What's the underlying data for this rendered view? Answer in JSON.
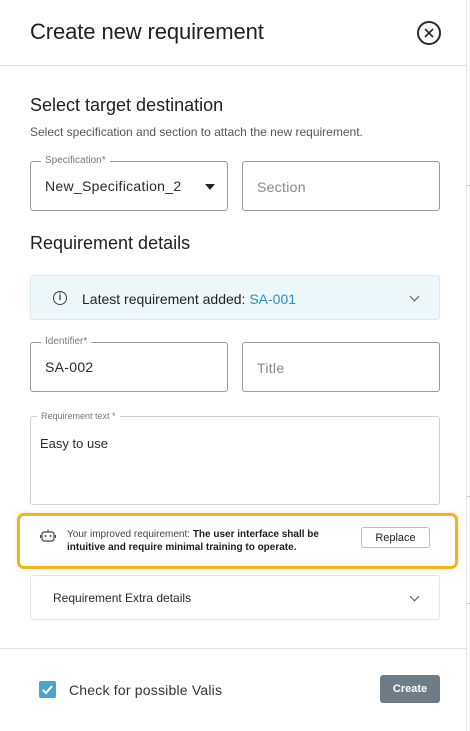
{
  "dialog": {
    "title": "Create new requirement"
  },
  "target": {
    "heading": "Select target destination",
    "subheading": "Select specification and section to attach the new requirement.",
    "specification": {
      "label": "Specification*",
      "value": "New_Specification_2"
    },
    "section": {
      "placeholder": "Section"
    }
  },
  "details": {
    "heading": "Requirement details",
    "latest": {
      "prefix": "Latest requirement added: ",
      "id": "SA-001"
    },
    "identifier": {
      "label": "Identifier*",
      "value": "SA-002"
    },
    "title_field": {
      "placeholder": "Title"
    },
    "requirement_text": {
      "label": "Requirement text *",
      "value": "Easy to use"
    }
  },
  "suggestion": {
    "prefix": "Your improved requirement: ",
    "text": "The user interface shall be intuitive and require minimal training to operate.",
    "replace_label": "Replace",
    "icon": "robot-icon"
  },
  "extra": {
    "label": "Requirement Extra details"
  },
  "footer": {
    "checkbox_label": "Check for possible Valis",
    "checkbox_checked": true,
    "create_label": "Create"
  },
  "colors": {
    "accent": "#2a8fbf",
    "highlight_border": "#f0b429",
    "checkbox": "#4fa3c7",
    "create_button": "#6f7c86",
    "info_bg": "#eef8fb"
  }
}
